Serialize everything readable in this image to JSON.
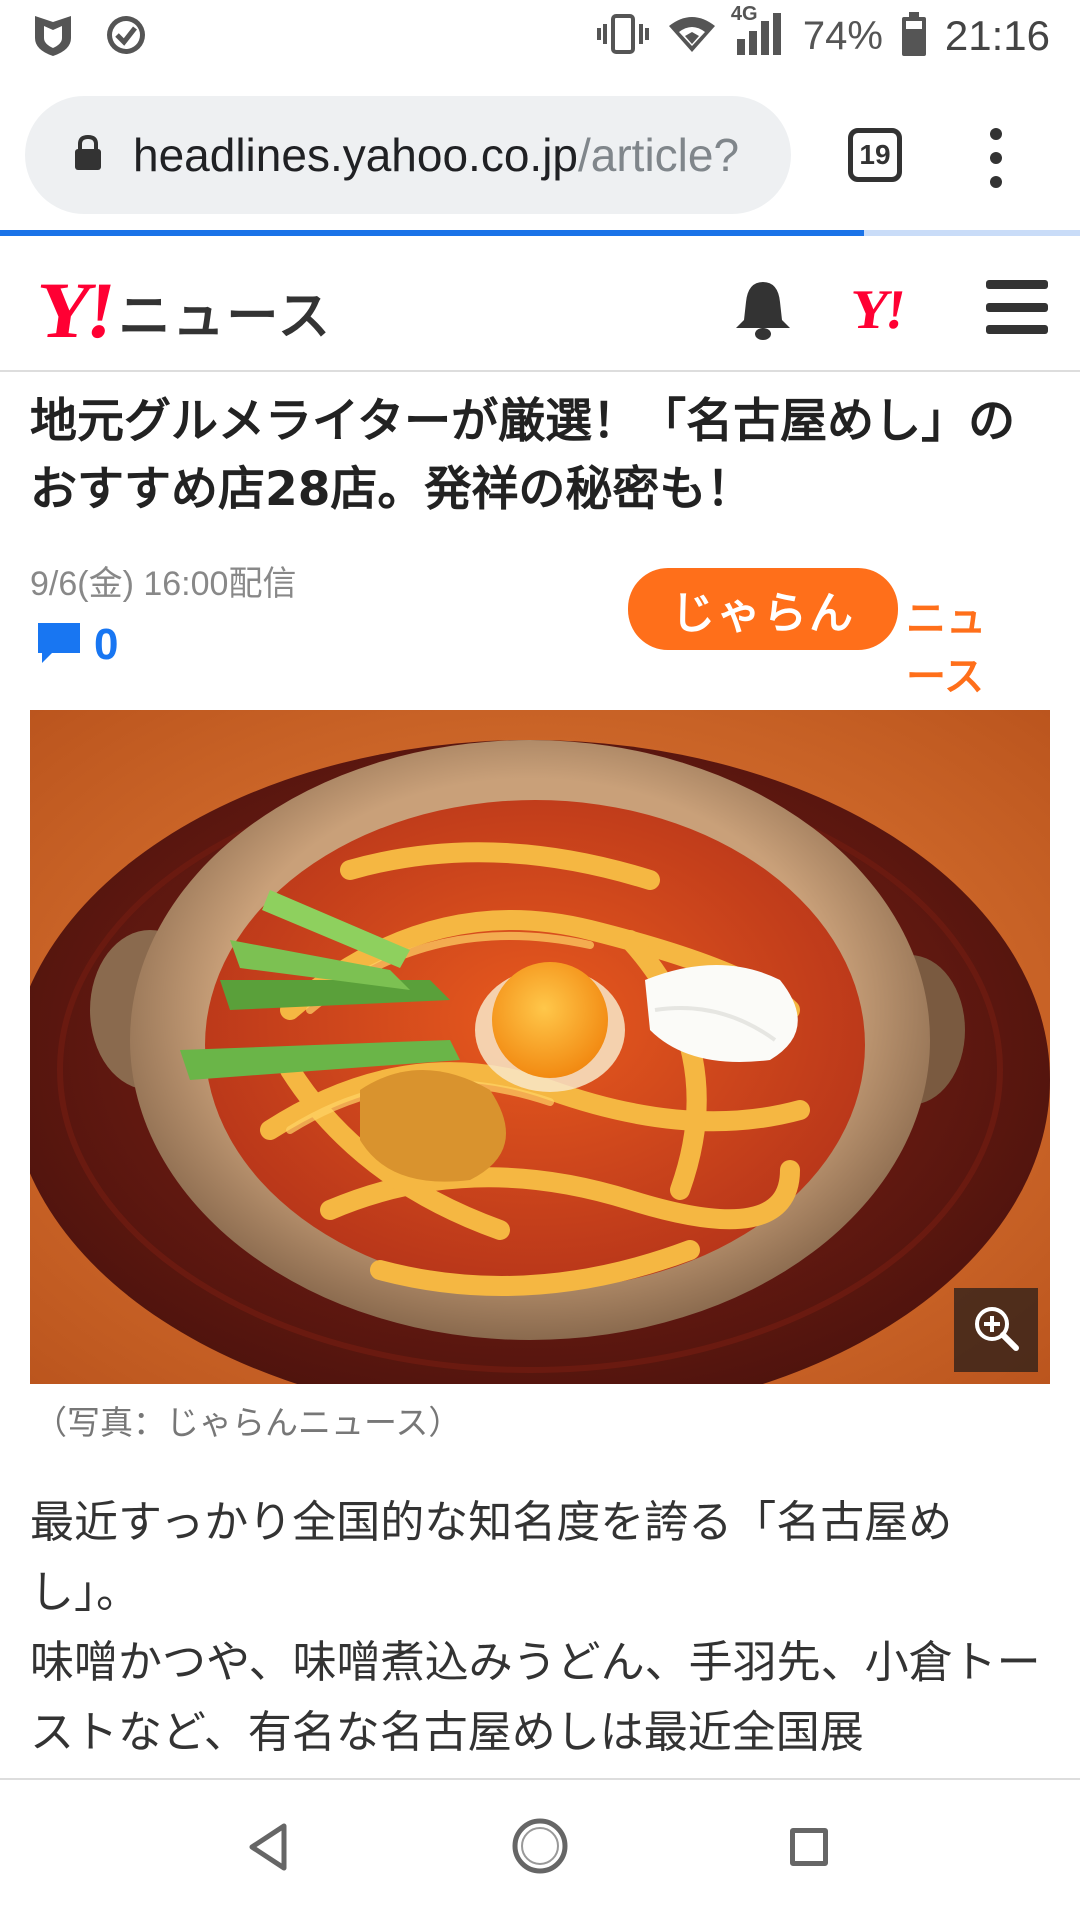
{
  "status_bar": {
    "battery": "74%",
    "time": "21:16",
    "network": "4G"
  },
  "browser": {
    "url_host": "headlines.yahoo.co.jp",
    "url_path": "/article?",
    "tab_count": "19",
    "page_load_progress": 0.8
  },
  "header": {
    "logo_y": "Y!",
    "logo_text": "ニュース",
    "mini_logo": "Y!"
  },
  "article": {
    "title": "地元グルメライターが厳選！「名古屋めし」のおすすめ店28店。発祥の秘密も！",
    "date": "9/6(金) 16:00配信",
    "comment_count": "0",
    "publisher_logo_main": "じゃらん",
    "publisher_logo_sub": "ニュース",
    "caption": "（写真：じゃらんニュース）",
    "body_lines": [
      "最近すっかり全国的な知名度を誇る「名古屋めし」。",
      "味噌かつや、味噌煮込みうどん、手羽先、小倉トーストなど、有名な名古屋めしは最近全国展"
    ]
  },
  "colors": {
    "yahoo_red": "#ff0033",
    "jalan_orange": "#ff6f1a",
    "link_blue": "#1876f2",
    "progress_blue": "#1a73e8"
  },
  "icons": {
    "status_left": [
      "shield-icon",
      "check-circle-icon"
    ],
    "status_right": [
      "vibrate-icon",
      "wifi-icon",
      "signal-icon",
      "battery-icon"
    ],
    "browser": [
      "lock-icon",
      "tab-switcher-icon",
      "kebab-menu-icon"
    ],
    "header": [
      "bell-icon",
      "hamburger-menu-icon"
    ],
    "article": [
      "comment-icon",
      "zoom-in-icon"
    ],
    "nav": [
      "back-icon",
      "home-icon",
      "recents-icon"
    ]
  }
}
